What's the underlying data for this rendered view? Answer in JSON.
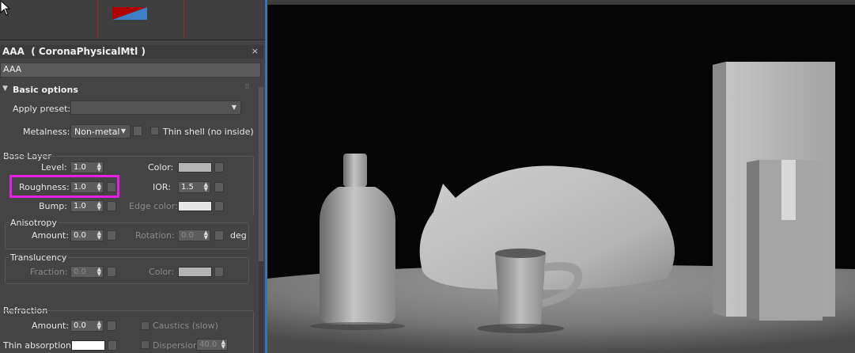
{
  "panel": {
    "material_title": "AAA  ( CoronaPhysicalMtl )",
    "close": "×",
    "material_name": "AAA",
    "rollout_arrow": "▼",
    "rollout_title": "Basic options",
    "grip": "⠿",
    "apply_preset_label": "Apply preset:",
    "apply_preset_value": "",
    "metalness_label": "Metalness:",
    "metalness_value": "Non-metal",
    "thin_shell_label": "Thin shell (no inside)"
  },
  "base_layer": {
    "header": "Base Layer",
    "level_label": "Level:",
    "level_value": "1.0",
    "color_label": "Color:",
    "color": "#b4b4b4",
    "roughness_label": "Roughness:",
    "roughness_value": "1.0",
    "ior_label": "IOR:",
    "ior_value": "1.5",
    "bump_label": "Bump:",
    "bump_value": "1.0",
    "edge_color_label": "Edge color:",
    "edge_color": "#e6e6e6"
  },
  "anisotropy": {
    "header": "Anisotropy",
    "amount_label": "Amount:",
    "amount_value": "0.0",
    "rotation_label": "Rotation:",
    "rotation_value": "0.0",
    "unit": "deg"
  },
  "translucency": {
    "header": "Translucency",
    "fraction_label": "Fraction:",
    "fraction_value": "0.0",
    "color_label": "Color:",
    "color": "#b4b4b4"
  },
  "refraction": {
    "header": "Refraction",
    "amount_label": "Amount:",
    "amount_value": "0.0",
    "caustics_label": "Caustics (slow)",
    "thin_absorption_label": "Thin absorption:",
    "thin_absorption_color": "#ffffff",
    "dispersion_label": "Dispersion",
    "dispersion_value": "40.0"
  },
  "colors": {
    "highlight": "#e61ee6",
    "separator": "#2e76bd",
    "swatch_red": "#b00000",
    "swatch_blue": "#3a7fc8"
  },
  "icons": {
    "cursor": "arrow-cursor-icon",
    "spinner": "spinner-arrows-icon",
    "dropdown": "dropdown-arrow-icon"
  }
}
